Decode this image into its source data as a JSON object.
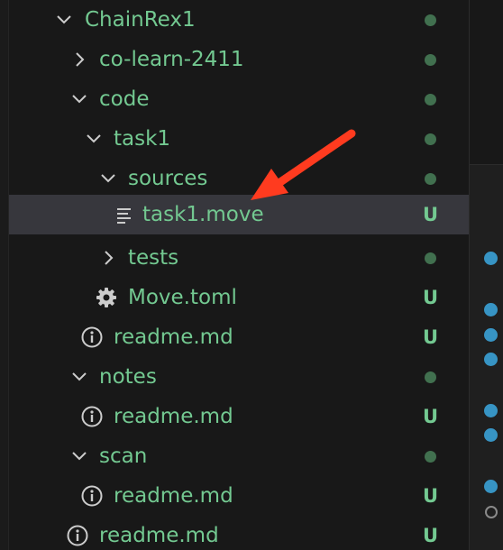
{
  "explorer": {
    "rows": [
      {
        "label": "ChainRex1",
        "badge": ""
      },
      {
        "label": "co-learn-2411",
        "badge": ""
      },
      {
        "label": "code",
        "badge": ""
      },
      {
        "label": "task1",
        "badge": ""
      },
      {
        "label": "sources",
        "badge": ""
      },
      {
        "label": "task1.move",
        "badge": "U"
      },
      {
        "label": "tests",
        "badge": ""
      },
      {
        "label": "Move.toml",
        "badge": "U"
      },
      {
        "label": "readme.md",
        "badge": "U"
      },
      {
        "label": "notes",
        "badge": ""
      },
      {
        "label": "readme.md",
        "badge": "U"
      },
      {
        "label": "scan",
        "badge": ""
      },
      {
        "label": "readme.md",
        "badge": "U"
      },
      {
        "label": "readme.md",
        "badge": "U"
      }
    ]
  },
  "colors": {
    "untracked_text": "#73c991",
    "modified_dot": "#41704f",
    "selection": "#37373d",
    "annotation_arrow": "#ff3b1f",
    "gutter_dot": "#3794c4"
  }
}
